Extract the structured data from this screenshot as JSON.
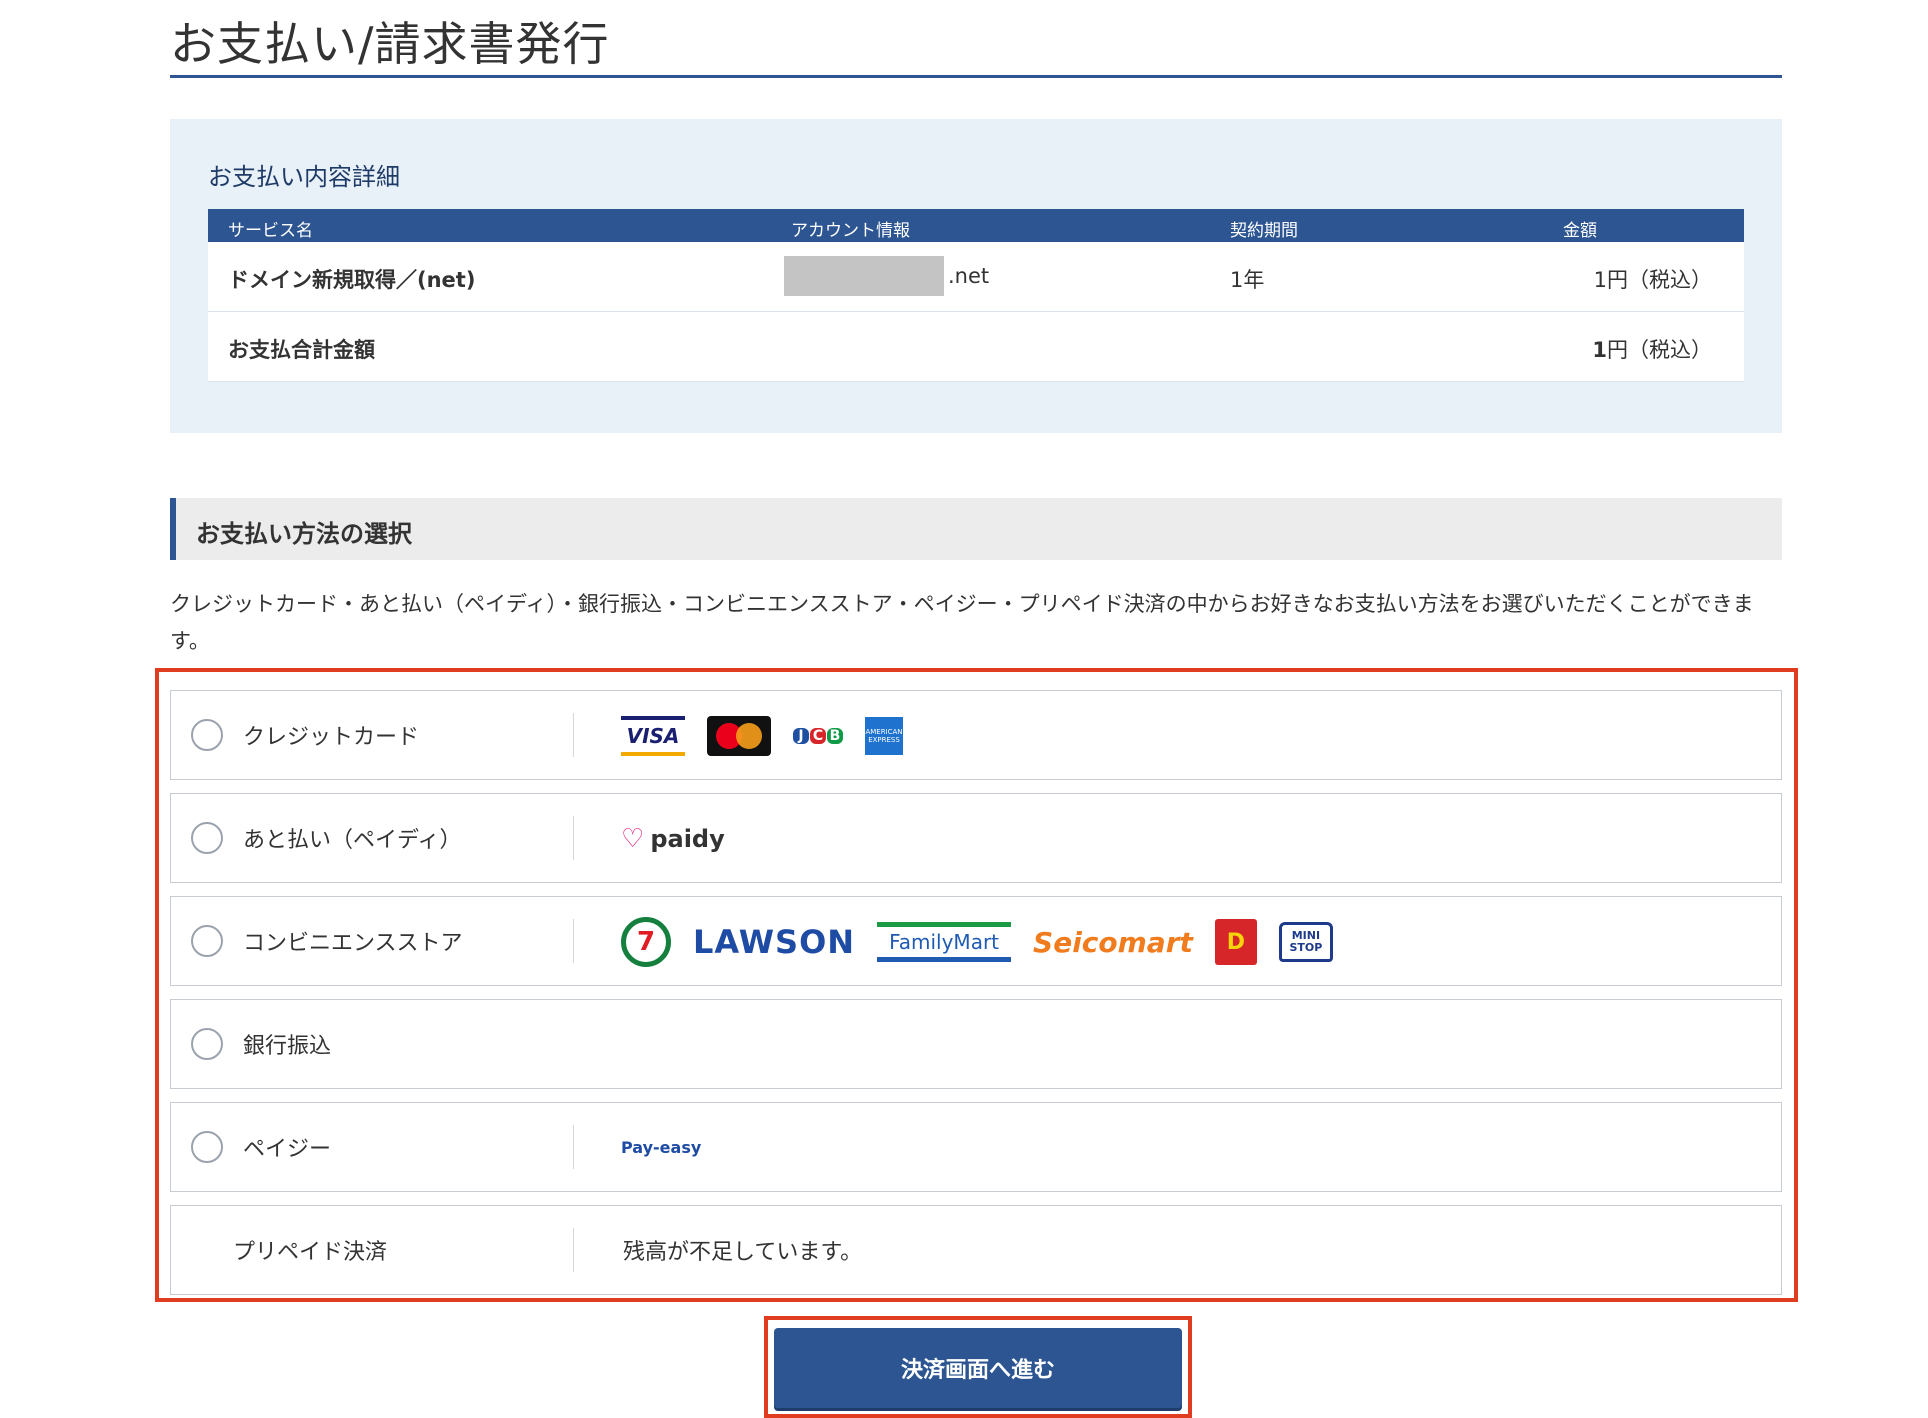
{
  "page": {
    "title": "お支払い/請求書発行"
  },
  "details": {
    "heading": "お支払い内容詳細",
    "columns": [
      "サービス名",
      "アカウント情報",
      "契約期間",
      "金額"
    ],
    "rows": [
      {
        "service": "ドメイン新規取得／(net)",
        "account": ".net",
        "period": "1年",
        "amount": "1円（税込）"
      }
    ],
    "total": {
      "label": "お支払合計金額",
      "amount_number": "1",
      "amount_suffix": "円（税込）"
    }
  },
  "payment": {
    "heading": "お支払い方法の選択",
    "description": "クレジットカード・あと払い（ペイディ）・銀行振込・コンビニエンスストア・ペイジー・プリペイド決済の中からお好きなお支払い方法をお選びいただくことができます。",
    "options": [
      {
        "label": "クレジットカード",
        "logos": [
          "visa-logo",
          "mastercard-logo",
          "jcb-logo",
          "amex-logo"
        ]
      },
      {
        "label": "あと払い（ペイディ）",
        "logos": [
          "paidy-logo"
        ]
      },
      {
        "label": "コンビニエンスストア",
        "logos": [
          "seven-eleven-logo",
          "lawson-logo",
          "familymart-logo",
          "seicomart-logo",
          "daily-yamazaki-logo",
          "ministop-logo"
        ]
      },
      {
        "label": "銀行振込",
        "logos": []
      },
      {
        "label": "ペイジー",
        "logos": [
          "payeasy-logo"
        ]
      },
      {
        "label": "プリペイド決済",
        "note": "残高が不足しています。"
      }
    ],
    "logo_text": {
      "visa": "VISA",
      "jcb": [
        "J",
        "C",
        "B"
      ],
      "amex": "AMERICAN EXPRESS",
      "paidy": "paidy",
      "seven": "7",
      "lawson": "LAWSON",
      "familymart": "FamilyMart",
      "seicomart": "Seicomart",
      "daily": "D",
      "ministop": "MINI STOP",
      "payeasy": "Pay-easy"
    }
  },
  "submit": {
    "label": "決済画面へ進む"
  },
  "colors": {
    "primary": "#2c5591",
    "highlight_frame": "#e03c1f",
    "detail_bg": "#e8f0f8"
  }
}
